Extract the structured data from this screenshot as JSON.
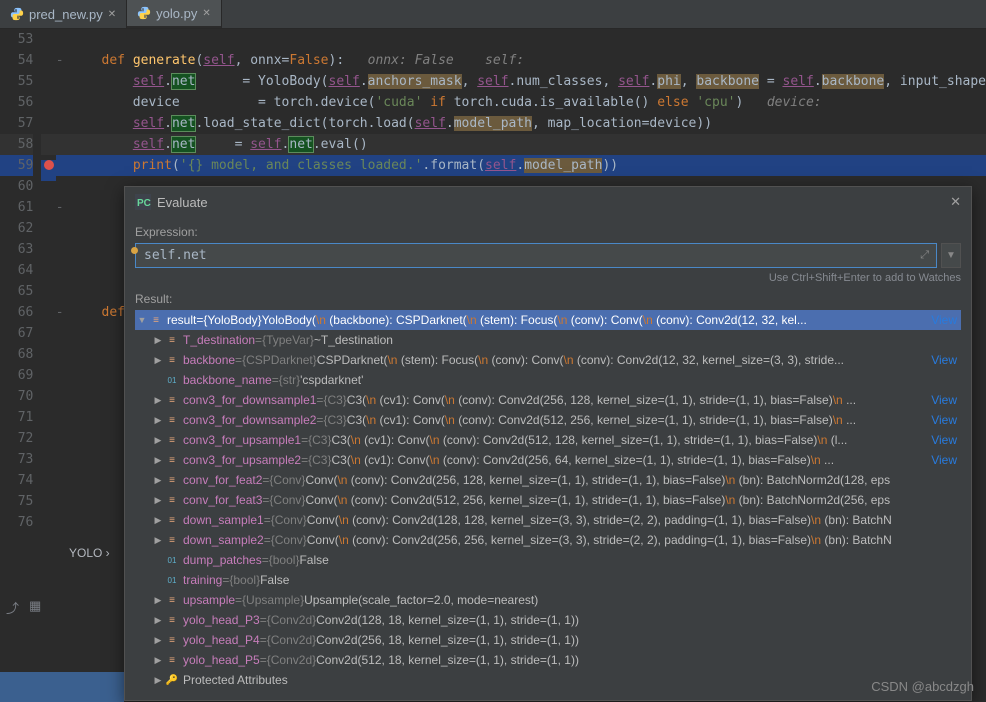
{
  "tabs": [
    {
      "label": "pred_new.py",
      "active": false
    },
    {
      "label": "yolo.py",
      "active": true
    }
  ],
  "gutter_start": 53,
  "code_lines": [
    {
      "n": 53,
      "html": ""
    },
    {
      "n": 54,
      "fold": "-",
      "html": "    <span class='kw'>def</span> <span class='fn'>generate</span>(<span class='self'>self</span>, onnx=<span class='kw'>False</span>):   <span class='comment'>onnx: False    self:</span>"
    },
    {
      "n": 55,
      "html": "        <span class='self'>self</span>.<span class='hl-net'>net</span>      = YoloBody(<span class='self'>self</span>.<span class='hl-bb'>anchors_mask</span>, <span class='self'>self</span>.num_classes, <span class='self'>self</span>.<span class='hl-bb'>phi</span>, <span class='hl-bb'>backbone</span> = <span class='self'>self</span>.<span class='hl-bb'>backbone</span>, input_shape"
    },
    {
      "n": 56,
      "html": "        device          = torch.device(<span class='str'>'cuda'</span> <span class='kw'>if</span> torch.cuda.is_available() <span class='kw'>else</span> <span class='str'>'cpu'</span>)   <span class='comment'>device:</span>"
    },
    {
      "n": 57,
      "html": "        <span class='self'>self</span>.<span class='hl-net'>net</span>.load_state_dict(torch.load(<span class='self'>self</span>.<span class='hl-bb'>model_path</span>, <span class='param'>map_location</span>=device))"
    },
    {
      "n": 58,
      "cls": "hl",
      "html": "        <span class='self'>self</span>.<span class='hl-net'>net</span>     = <span class='self'>self</span>.<span class='hl-net'>net</span>.eval()"
    },
    {
      "n": 59,
      "cls": "sel",
      "bp": true,
      "html": "        <span class='kw'>print</span>(<span class='str'>'{} model, and classes loaded.'</span>.format(<span class='self'>self</span>.<span class='hl-bb'>model_path</span>))"
    },
    {
      "n": 60,
      "html": ""
    },
    {
      "n": 61,
      "fold": "-",
      "html": ""
    },
    {
      "n": 62,
      "html": ""
    },
    {
      "n": 63,
      "html": ""
    },
    {
      "n": 64,
      "html": ""
    },
    {
      "n": 65,
      "html": ""
    },
    {
      "n": 66,
      "fold": "-",
      "html": "    <span class='kw'>def</span>"
    },
    {
      "n": 67,
      "html": ""
    },
    {
      "n": 68,
      "html": ""
    },
    {
      "n": 69,
      "html": ""
    },
    {
      "n": 70,
      "html": ""
    },
    {
      "n": 71,
      "html": ""
    },
    {
      "n": 72,
      "html": ""
    },
    {
      "n": 73,
      "html": ""
    },
    {
      "n": 74,
      "html": ""
    },
    {
      "n": 75,
      "html": ""
    },
    {
      "n": 76,
      "html": ""
    }
  ],
  "dialog": {
    "title": "Evaluate",
    "expr_label": "Expression:",
    "expr_value": "self.net",
    "hint": "Use Ctrl+Shift+Enter to add to Watches",
    "result_label": "Result:"
  },
  "result_tree": [
    {
      "depth": 0,
      "arrow": "open",
      "icon": "f",
      "name": "result",
      "selected": true,
      "eq": " = ",
      "gray": "{YoloBody}",
      "val": " YoloBody(\\n   (backbone): CSPDarknet(\\n     (stem): Focus(\\n       (conv): Conv(\\n         (conv): Conv2d(12, 32, kel...",
      "view": "View"
    },
    {
      "depth": 1,
      "arrow": "closed",
      "icon": "f",
      "name": "T_destination",
      "eq": " = ",
      "gray": "{TypeVar}",
      "val": " ~T_destination"
    },
    {
      "depth": 1,
      "arrow": "closed",
      "icon": "f",
      "name": "backbone",
      "eq": " = ",
      "gray": "{CSPDarknet}",
      "val": " CSPDarknet(\\n   (stem): Focus(\\n     (conv): Conv(\\n       (conv): Conv2d(12, 32, kernel_size=(3, 3), stride...",
      "view": "View"
    },
    {
      "depth": 1,
      "arrow": "none",
      "icon": "01",
      "name": "backbone_name",
      "eq": " = ",
      "gray": "{str}",
      "val": " 'cspdarknet'"
    },
    {
      "depth": 1,
      "arrow": "closed",
      "icon": "f",
      "name": "conv3_for_downsample1",
      "eq": " = ",
      "gray": "{C3}",
      "val": " C3(\\n   (cv1): Conv(\\n     (conv): Conv2d(256, 128, kernel_size=(1, 1), stride=(1, 1), bias=False)\\n ...",
      "view": "View"
    },
    {
      "depth": 1,
      "arrow": "closed",
      "icon": "f",
      "name": "conv3_for_downsample2",
      "eq": " = ",
      "gray": "{C3}",
      "val": " C3(\\n   (cv1): Conv(\\n     (conv): Conv2d(512, 256, kernel_size=(1, 1), stride=(1, 1), bias=False)\\n ...",
      "view": "View"
    },
    {
      "depth": 1,
      "arrow": "closed",
      "icon": "f",
      "name": "conv3_for_upsample1",
      "eq": " = ",
      "gray": "{C3}",
      "val": " C3(\\n   (cv1): Conv(\\n     (conv): Conv2d(512, 128, kernel_size=(1, 1), stride=(1, 1), bias=False)\\n     (l...",
      "view": "View"
    },
    {
      "depth": 1,
      "arrow": "closed",
      "icon": "f",
      "name": "conv3_for_upsample2",
      "eq": " = ",
      "gray": "{C3}",
      "val": " C3(\\n   (cv1): Conv(\\n     (conv): Conv2d(256, 64, kernel_size=(1, 1), stride=(1, 1), bias=False)\\n  ...",
      "view": "View"
    },
    {
      "depth": 1,
      "arrow": "closed",
      "icon": "f",
      "name": "conv_for_feat2",
      "eq": " = ",
      "gray": "{Conv}",
      "val": " Conv(\\n   (conv): Conv2d(256, 128, kernel_size=(1, 1), stride=(1, 1), bias=False)\\n   (bn): BatchNorm2d(128, eps"
    },
    {
      "depth": 1,
      "arrow": "closed",
      "icon": "f",
      "name": "conv_for_feat3",
      "eq": " = ",
      "gray": "{Conv}",
      "val": " Conv(\\n   (conv): Conv2d(512, 256, kernel_size=(1, 1), stride=(1, 1), bias=False)\\n   (bn): BatchNorm2d(256, eps"
    },
    {
      "depth": 1,
      "arrow": "closed",
      "icon": "f",
      "name": "down_sample1",
      "eq": " = ",
      "gray": "{Conv}",
      "val": " Conv(\\n   (conv): Conv2d(128, 128, kernel_size=(3, 3), stride=(2, 2), padding=(1, 1), bias=False)\\n   (bn): BatchN"
    },
    {
      "depth": 1,
      "arrow": "closed",
      "icon": "f",
      "name": "down_sample2",
      "eq": " = ",
      "gray": "{Conv}",
      "val": " Conv(\\n   (conv): Conv2d(256, 256, kernel_size=(3, 3), stride=(2, 2), padding=(1, 1), bias=False)\\n   (bn): BatchN"
    },
    {
      "depth": 1,
      "arrow": "none",
      "icon": "01",
      "name": "dump_patches",
      "eq": " = ",
      "gray": "{bool}",
      "val": " False"
    },
    {
      "depth": 1,
      "arrow": "none",
      "icon": "01",
      "name": "training",
      "eq": " = ",
      "gray": "{bool}",
      "val": " False"
    },
    {
      "depth": 1,
      "arrow": "closed",
      "icon": "f",
      "name": "upsample",
      "eq": " = ",
      "gray": "{Upsample}",
      "val": " Upsample(scale_factor=2.0, mode=nearest)"
    },
    {
      "depth": 1,
      "arrow": "closed",
      "icon": "f",
      "name": "yolo_head_P3",
      "eq": " = ",
      "gray": "{Conv2d}",
      "val": " Conv2d(128, 18, kernel_size=(1, 1), stride=(1, 1))"
    },
    {
      "depth": 1,
      "arrow": "closed",
      "icon": "f",
      "name": "yolo_head_P4",
      "eq": " = ",
      "gray": "{Conv2d}",
      "val": " Conv2d(256, 18, kernel_size=(1, 1), stride=(1, 1))"
    },
    {
      "depth": 1,
      "arrow": "closed",
      "icon": "f",
      "name": "yolo_head_P5",
      "eq": " = ",
      "gray": "{Conv2d}",
      "val": " Conv2d(512, 18, kernel_size=(1, 1), stride=(1, 1))"
    },
    {
      "depth": 1,
      "arrow": "closed",
      "icon": "key",
      "name": "Protected Attributes",
      "plain": true
    }
  ],
  "yolo_label": "YOLO  ›",
  "watermark": "CSDN @abcdzgh"
}
